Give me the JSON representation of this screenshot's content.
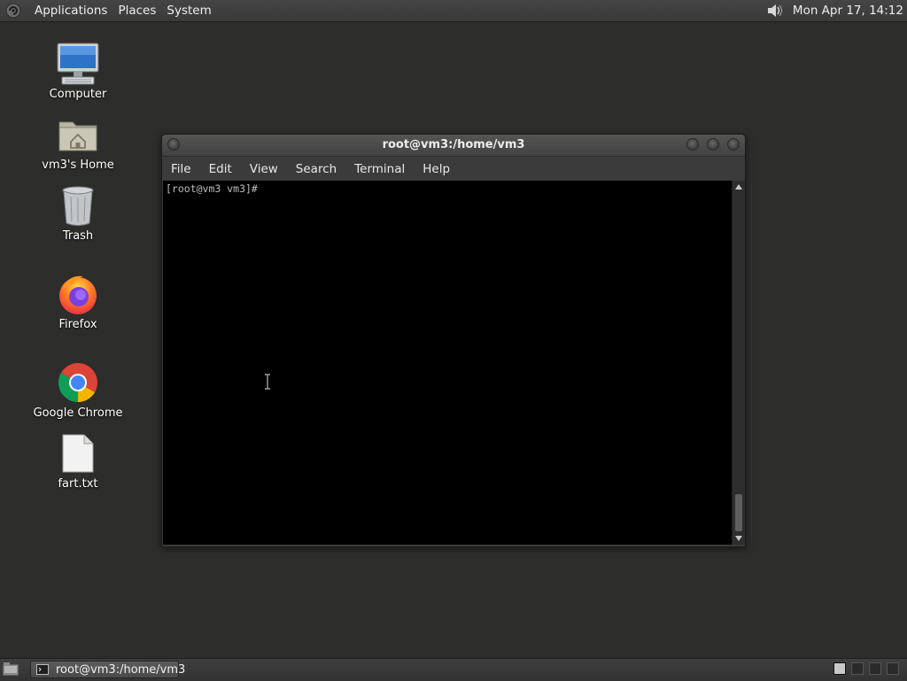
{
  "top_panel": {
    "menus": [
      "Applications",
      "Places",
      "System"
    ],
    "clock": "Mon Apr 17, 14:12",
    "logo_icon": "distro-logo-icon",
    "volume_icon": "volume-icon"
  },
  "desktop": {
    "icons": [
      {
        "label": "Computer",
        "icon": "computer-icon"
      },
      {
        "label": "vm3's Home",
        "icon": "home-folder-icon"
      },
      {
        "label": "Trash",
        "icon": "trash-icon"
      },
      {
        "label": "Firefox",
        "icon": "firefox-icon"
      },
      {
        "label": "Google Chrome",
        "icon": "chrome-icon"
      },
      {
        "label": "fart.txt",
        "icon": "text-file-icon"
      }
    ]
  },
  "terminal": {
    "title": "root@vm3:/home/vm3",
    "menu": [
      "File",
      "Edit",
      "View",
      "Search",
      "Terminal",
      "Help"
    ],
    "prompt": "[root@vm3 vm3]#",
    "scroll_position": 1.0
  },
  "bottom_panel": {
    "task_label": "root@vm3:/home/vm3",
    "task_icon": "terminal-icon",
    "workspaces": 4,
    "active_workspace": 1
  },
  "colors": {
    "desktop_bg": "#2d2d2b",
    "panel_bg": "#3c3c3c",
    "terminal_bg": "#000000",
    "terminal_fg": "#bdbdbd"
  }
}
